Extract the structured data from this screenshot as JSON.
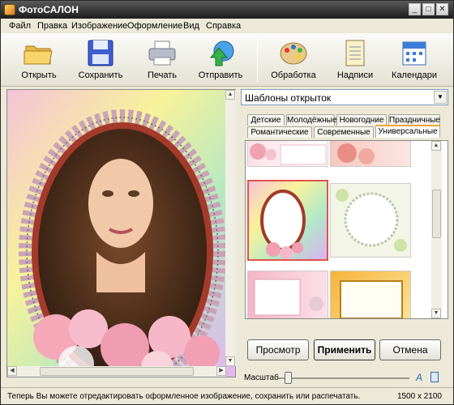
{
  "window": {
    "title": "ФотоСАЛОН",
    "controls": {
      "minimize": "_",
      "maximize": "□",
      "close": "✕"
    }
  },
  "menu": [
    "Файл",
    "Правка",
    "Изображение",
    "Оформление",
    "Вид",
    "Справка"
  ],
  "toolbar": {
    "open": "Открыть",
    "save": "Сохранить",
    "print": "Печать",
    "send": "Отправить",
    "process": "Обработка",
    "captions": "Надписи",
    "calendars": "Календари"
  },
  "panel": {
    "template_select": "Шаблоны открыток",
    "tabs_row1": [
      "Детские",
      "Молодёжные",
      "Новогодние",
      "Праздничные"
    ],
    "tabs_row2": [
      "Романтические",
      "Современные",
      "Универсальные"
    ],
    "active_tab": "Универсальные"
  },
  "buttons": {
    "preview": "Просмотр",
    "apply": "Применить",
    "cancel": "Отмена"
  },
  "zoom": {
    "label": "Масштаб",
    "level": 0.05
  },
  "status": {
    "message": "Теперь Вы можете отредактировать оформленное изображение, сохранить или распечатать.",
    "image_size": "1500 x 2100"
  },
  "colors": {
    "title_bar": "#2b2b2b",
    "selection": "#e0524a",
    "active_tab": "#f2a33a"
  }
}
